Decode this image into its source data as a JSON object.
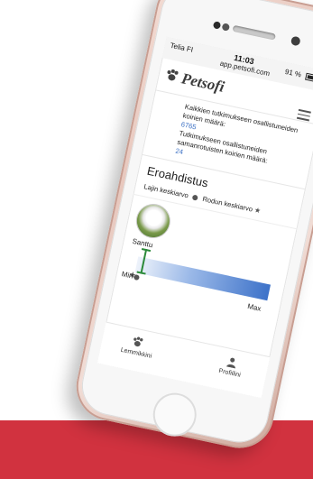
{
  "status_bar": {
    "carrier": "Telia FI",
    "time": "11:03",
    "url": "app.petsofi.com",
    "battery": "91 %"
  },
  "app": {
    "logo_text": "Petsofi"
  },
  "stats": {
    "total_label": "Kaikkien tutkimukseen osallistuneiden koirien määrä:",
    "total_value": "6765",
    "breed_label": "Tutkimukseen osallistuneiden samanrotuisten koirien määrä:",
    "breed_value": "24"
  },
  "section": {
    "title": "Eroahdistus",
    "legend_species": "Lajin keskiarvo",
    "legend_breed": "Rodun keskiarvo"
  },
  "pet": {
    "name": "Santtu"
  },
  "scale": {
    "min_label": "Min",
    "max_label": "Max"
  },
  "nav": {
    "pets_label": "Lemmikkini",
    "profile_label": "Profiilini"
  },
  "colors": {
    "accent_red": "#d1323f",
    "link_blue": "#3a6fc4",
    "bar_blue": "#3d72c9",
    "marker_green": "#2c8a3a"
  }
}
